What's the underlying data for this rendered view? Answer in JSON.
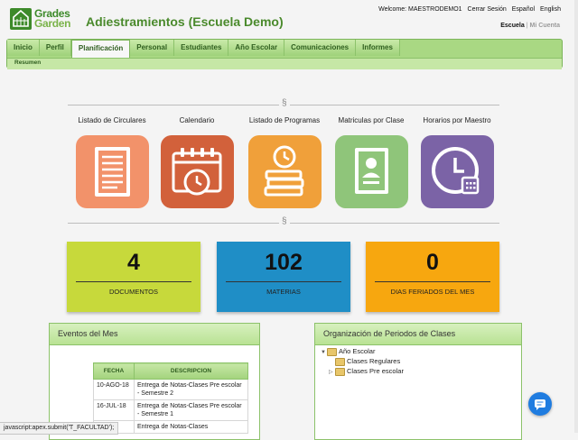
{
  "logo": {
    "line1": "Grades",
    "line2": "Garden"
  },
  "header": {
    "title": "Adiestramientos (Escuela Demo)",
    "welcome": "Welcome: MAESTRODEMO1",
    "logout": "Cerrar Sesión",
    "lang_es": "Español",
    "lang_en": "English",
    "scope_active": "Escuela",
    "scope_sep": "|",
    "scope_other": "Mi Cuenta"
  },
  "nav": {
    "tabs": [
      "Inicio",
      "Perfil",
      "Planificación",
      "Personal",
      "Estudiantes",
      "Año Escolar",
      "Comunicaciones",
      "Informes"
    ],
    "active_tab": "Planificación",
    "sub": "Resumen"
  },
  "section_mark": "§",
  "shortcuts": [
    {
      "label": "Listado de Circulares",
      "icon": "document-list-icon",
      "color": "#f2926a"
    },
    {
      "label": "Calendario",
      "icon": "calendar-clock-icon",
      "color": "#d2613b"
    },
    {
      "label": "Listado de Programas",
      "icon": "books-clock-icon",
      "color": "#f0a03a"
    },
    {
      "label": "Matriculas por Clase",
      "icon": "student-id-card-icon",
      "color": "#8fc57a"
    },
    {
      "label": "Horarios por Maestro",
      "icon": "clock-calendar-icon",
      "color": "#7b63a6"
    }
  ],
  "stats": [
    {
      "value": "4",
      "label": "DOCUMENTOS",
      "color": "#c7d93b"
    },
    {
      "value": "102",
      "label": "MATERIAS",
      "color": "#1f8ec6"
    },
    {
      "value": "0",
      "label": "DIAS FERIADOS DEL MES",
      "color": "#f7a70f"
    }
  ],
  "events": {
    "title": "Eventos del Mes",
    "columns": [
      "FECHA",
      "DESCRIPCION"
    ],
    "rows": [
      [
        "10-AGO-18",
        "Entrega de Notas-Clases Pre escolar - Semestre 2"
      ],
      [
        "16-JUL-18",
        "Entrega de Notas-Clases Pre escolar - Semestre 1"
      ],
      [
        "",
        "Entrega de Notas-Clases"
      ]
    ]
  },
  "periods": {
    "title": "Organización de Periodos de Clases",
    "root": "Año Escolar",
    "children": [
      "Clases Regulares",
      "Clases Pre escolar"
    ]
  },
  "status_bar": "javascript:apex.submit('T_FACULTAD');"
}
